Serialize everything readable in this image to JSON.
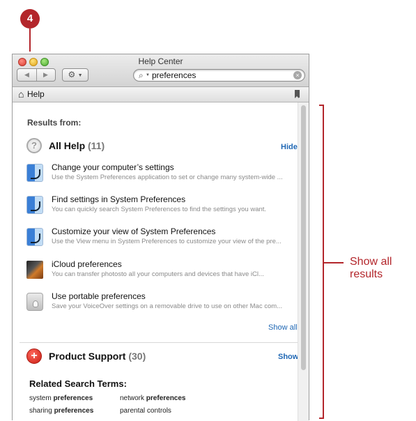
{
  "step": {
    "number": "4"
  },
  "window": {
    "title": "Help Center"
  },
  "toolbar": {
    "back": "◀",
    "forward": "▶",
    "gear": "⚙"
  },
  "search": {
    "value": "preferences"
  },
  "pathbar": {
    "home": "Help"
  },
  "content": {
    "results_from": "Results from:",
    "all_help": {
      "icon_char": "?",
      "title": "All Help",
      "count": "(11)",
      "toggle": "Hide"
    },
    "results": [
      {
        "title": "Change your computer’s settings",
        "desc": "Use the System Preferences application to set or change many system-wide ...",
        "icon": "system-preferences-icon"
      },
      {
        "title": "Find settings in System Preferences",
        "desc": "You can quickly search System Preferences to find the settings you want.",
        "icon": "system-preferences-icon"
      },
      {
        "title": "Customize your view of System Preferences",
        "desc": "Use the View menu in System Preferences to customize your view of the pre...",
        "icon": "system-preferences-icon"
      },
      {
        "title": "iCloud preferences",
        "desc": "You can transfer photosto all your computers and devices that have iCl...",
        "icon": "iphoto-icon"
      },
      {
        "title": "Use portable preferences",
        "desc": "Save your VoiceOver settings on a removable drive to use on other Mac com...",
        "icon": "voiceover-utility-icon"
      }
    ],
    "show_all": "Show all",
    "product_support": {
      "icon_char": "+",
      "title": "Product Support",
      "count": "(30)",
      "toggle": "Show"
    },
    "related": {
      "title": "Related Search Terms:",
      "terms": [
        {
          "prefix": "system ",
          "bold": "preferences"
        },
        {
          "prefix": "network ",
          "bold": "preferences"
        },
        {
          "prefix": "sharing ",
          "bold": "preferences"
        },
        {
          "prefix": "parental controls",
          "bold": ""
        }
      ]
    }
  },
  "callout": {
    "label": "Show all results"
  },
  "colors": {
    "accent": "#b3262b",
    "link": "#1f67b4"
  }
}
